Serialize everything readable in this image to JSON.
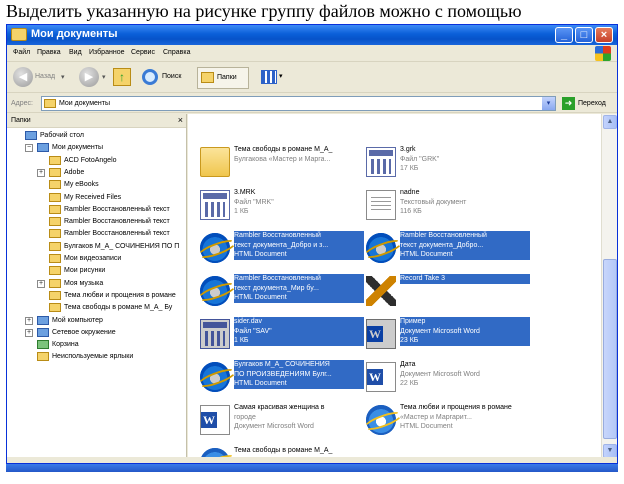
{
  "caption": "Выделить указанную на рисунке группу файлов можно с помощью",
  "window": {
    "title": "Мои документы"
  },
  "menu": [
    "Файл",
    "Правка",
    "Вид",
    "Избранное",
    "Сервис",
    "Справка"
  ],
  "toolbar": {
    "back_label": "Назад",
    "search_label": "Поиск",
    "folders_label": "Папки"
  },
  "address": {
    "label": "Адрес:",
    "value": "Мои документы",
    "go_label": "Переход"
  },
  "tree": {
    "header": "Папки",
    "items": [
      {
        "label": "Рабочий стол",
        "level": 0,
        "expander": "",
        "icon": "desktop-icon"
      },
      {
        "label": "Мои документы",
        "level": 1,
        "expander": "−",
        "icon": "my-documents-icon"
      },
      {
        "label": "ACD FotoAngelo",
        "level": 2,
        "expander": "",
        "icon": "folder-icon"
      },
      {
        "label": "Adobe",
        "level": 2,
        "expander": "+",
        "icon": "folder-icon"
      },
      {
        "label": "My eBooks",
        "level": 2,
        "expander": "",
        "icon": "folder-icon"
      },
      {
        "label": "My Received Files",
        "level": 2,
        "expander": "",
        "icon": "folder-icon"
      },
      {
        "label": "Rambler Восстановленный текст",
        "level": 2,
        "expander": "",
        "icon": "folder-icon"
      },
      {
        "label": "Rambler Восстановленный текст",
        "level": 2,
        "expander": "",
        "icon": "folder-icon"
      },
      {
        "label": "Rambler Восстановленный текст",
        "level": 2,
        "expander": "",
        "icon": "folder-icon"
      },
      {
        "label": "Булгаков М_А_ СОЧИНЕНИЯ ПО П",
        "level": 2,
        "expander": "",
        "icon": "folder-icon"
      },
      {
        "label": "Мои видеозаписи",
        "level": 2,
        "expander": "",
        "icon": "folder-icon"
      },
      {
        "label": "Мои рисунки",
        "level": 2,
        "expander": "",
        "icon": "folder-icon"
      },
      {
        "label": "Моя музыка",
        "level": 2,
        "expander": "+",
        "icon": "folder-icon"
      },
      {
        "label": "Тема любви и прощения в романе",
        "level": 2,
        "expander": "",
        "icon": "folder-icon"
      },
      {
        "label": "Тема свободы в романе М_А_ Бу",
        "level": 2,
        "expander": "",
        "icon": "folder-icon"
      },
      {
        "label": "Мой компьютер",
        "level": 1,
        "expander": "+",
        "icon": "computer-icon"
      },
      {
        "label": "Сетевое окружение",
        "level": 1,
        "expander": "+",
        "icon": "network-icon"
      },
      {
        "label": "Корзина",
        "level": 1,
        "expander": "",
        "icon": "recycle-bin-icon"
      },
      {
        "label": "Неиспользуемые ярлыки",
        "level": 1,
        "expander": "",
        "icon": "folder-icon"
      }
    ]
  },
  "files": [
    {
      "name": "Тема свободы в романе М_А_",
      "type": "Булгакова «Мастер и Марга...",
      "size": "",
      "icon": "folder-icon",
      "selected": false
    },
    {
      "name": "3.grk",
      "type": "Файл \"GRK\"",
      "size": "17 КБ",
      "icon": "calendar-file-icon",
      "selected": false
    },
    {
      "name": "3.MRK",
      "type": "Файл \"MRK\"",
      "size": "1 КБ",
      "icon": "calendar-file-icon",
      "selected": false
    },
    {
      "name": "nadne",
      "type": "Текстовый документ",
      "size": "116 КБ",
      "icon": "text-document-icon",
      "selected": false
    },
    {
      "name": "Rambler Восстановленный",
      "type": "текст документа_Добро и з...",
      "size": "HTML Document",
      "icon": "ie-html-icon",
      "selected": true
    },
    {
      "name": "Rambler Восстановленный",
      "type": "текст документа_Добро...",
      "size": "HTML Document",
      "icon": "ie-html-icon",
      "selected": true
    },
    {
      "name": "Rambler Восстановленный",
      "type": "текст документа_Мир бу...",
      "size": "HTML Document",
      "icon": "ie-html-icon",
      "selected": true
    },
    {
      "name": "Record Take 3",
      "type": "",
      "size": "",
      "icon": "winamp-icon",
      "selected": true
    },
    {
      "name": "sider.dav",
      "type": "Файл \"SAV\"",
      "size": "1 КБ",
      "icon": "calendar-file-icon",
      "selected": true
    },
    {
      "name": "Пример",
      "type": "Документ Microsoft Word",
      "size": "23 КБ",
      "icon": "word-document-icon",
      "selected": true
    },
    {
      "name": "Булгаков М_А_ СОЧИНЕНИЯ",
      "type": "ПО ПРОИЗВЕДЕНИЯМ Булг...",
      "size": "HTML Document",
      "icon": "ie-html-icon",
      "selected": true
    },
    {
      "name": "Дата",
      "type": "Документ Microsoft Word",
      "size": "22 КБ",
      "icon": "word-document-icon",
      "selected": false
    },
    {
      "name": "Самая красивая женщина в",
      "type": "городе",
      "size": "Документ Microsoft Word",
      "icon": "word-document-icon",
      "selected": false
    },
    {
      "name": "Тема любви и прощения в романе",
      "type": "«Мастер и Маргарит...",
      "size": "HTML Document",
      "icon": "ie-html-icon",
      "selected": false
    },
    {
      "name": "Тема свободы в романе М_А_",
      "type": "Булгакова «Мастер и Марга...",
      "size": "HTML Document",
      "icon": "ie-html-icon",
      "selected": false
    }
  ]
}
